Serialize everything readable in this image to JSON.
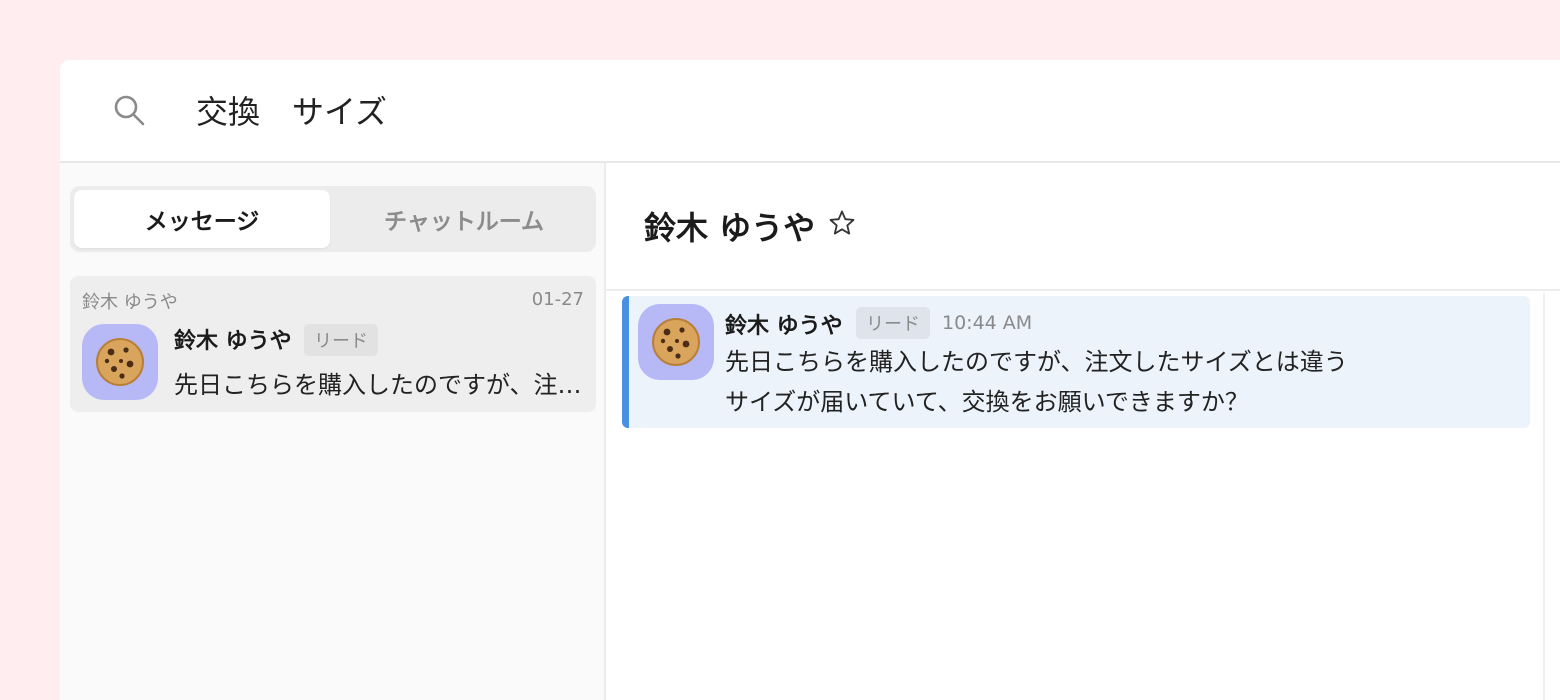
{
  "search": {
    "query": "交換　サイズ",
    "icon": "search-icon"
  },
  "tabs": {
    "messages_label": "メッセージ",
    "chatrooms_label": "チャットルーム",
    "active": "messages"
  },
  "conversation_list": [
    {
      "header_name": "鈴木 ゆうや",
      "date": "01-27",
      "name": "鈴木 ゆうや",
      "badge": "リード",
      "preview": "先日こちらを購入したのですが、注文したサイズとは違うサイズが届いていて、交換をお願いできますか？",
      "avatar": "cookie-icon"
    }
  ],
  "chat": {
    "title": "鈴木 ゆうや",
    "star_icon": "star-icon",
    "messages": [
      {
        "sender": "鈴木 ゆうや",
        "badge": "リード",
        "time": "10:44 AM",
        "text": "先日こちらを購入したのですが、注文したサイズとは違う\nサイズが届いていて、交換をお願いできますか？",
        "avatar": "cookie-icon"
      }
    ]
  },
  "colors": {
    "page_background": "#ffedf0",
    "avatar_background": "#b6b9f5",
    "message_highlight": "#edf3fb",
    "accent": "#4a90e2"
  }
}
